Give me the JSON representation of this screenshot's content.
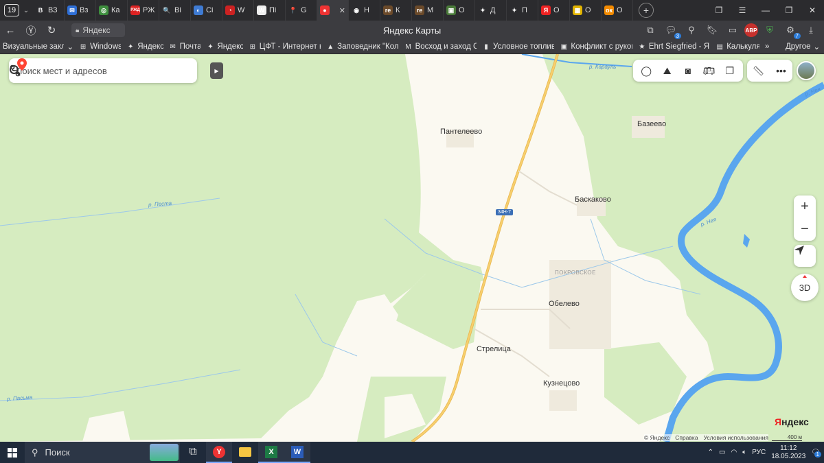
{
  "browser": {
    "tab_count": "19",
    "tabs": [
      {
        "label": "ВЗ",
        "icon": "b-logo-icon",
        "color": "#2b2b2e",
        "glyph": "B"
      },
      {
        "label": "Вз",
        "icon": "mail-icon",
        "color": "#2f6fd6",
        "glyph": "✉"
      },
      {
        "label": "Ка",
        "icon": "green-circle-icon",
        "color": "#3e8e3e",
        "glyph": "◎"
      },
      {
        "label": "РЖ",
        "icon": "rzd-icon",
        "color": "#d22",
        "glyph": "РЖД"
      },
      {
        "label": "Ві",
        "icon": "search-blue-icon",
        "color": "#2b2b2e",
        "glyph": "🔍"
      },
      {
        "label": "Сі",
        "icon": "globe-icon",
        "color": "#3f7bd3",
        "glyph": "◐"
      },
      {
        "label": "W",
        "icon": "red-swirl-icon",
        "color": "#c22",
        "glyph": "◔"
      },
      {
        "label": "Пі",
        "icon": "wikipedia-icon",
        "color": "#eee",
        "glyph": "W"
      },
      {
        "label": "G",
        "icon": "maps-pin-icon",
        "color": "#2b2b2e",
        "glyph": "📍"
      },
      {
        "label": "",
        "icon": "yandex-maps-icon",
        "color": "#e33",
        "glyph": "●",
        "active": true
      },
      {
        "label": "Н",
        "icon": "location-icon",
        "color": "#2b2b2e",
        "glyph": "◉"
      },
      {
        "label": "К",
        "icon": "re-icon",
        "color": "#6b4a2a",
        "glyph": "re"
      },
      {
        "label": "М",
        "icon": "re-icon",
        "color": "#6b4a2a",
        "glyph": "re"
      },
      {
        "label": "О",
        "icon": "picture-icon",
        "color": "#4a7a3a",
        "glyph": "▣"
      },
      {
        "label": "Д",
        "icon": "sparkle-icon",
        "color": "#2b2b2e",
        "glyph": "✦"
      },
      {
        "label": "П",
        "icon": "sparkle-icon",
        "color": "#2b2b2e",
        "glyph": "✦"
      },
      {
        "label": "О",
        "icon": "yandex-icon",
        "color": "#e22",
        "glyph": "Я"
      },
      {
        "label": "О",
        "icon": "yellow-grid-icon",
        "color": "#e2b400",
        "glyph": "▦"
      },
      {
        "label": "О",
        "icon": "ok-icon",
        "color": "#f28a00",
        "glyph": "ок"
      }
    ],
    "close_glyph": "✕",
    "new_tab_glyph": "+",
    "url_host": "Яндекс",
    "page_title": "Яндекс Карты",
    "addr_badge": "3",
    "abp_label": "ABP",
    "ext_badge": "7",
    "bookmarks": [
      {
        "label": "Визуальные закладк",
        "icon": "none",
        "glyph": ""
      },
      {
        "label": "Windows",
        "icon": "windows-icon",
        "glyph": "⊞"
      },
      {
        "label": "Яндекс",
        "icon": "sparkle-icon",
        "glyph": "✦"
      },
      {
        "label": "Почта",
        "icon": "mail-icon",
        "glyph": "✉"
      },
      {
        "label": "Яндекс",
        "icon": "sparkle-icon",
        "glyph": "✦"
      },
      {
        "label": "ЦФТ - Интернет н",
        "icon": "grid-icon",
        "glyph": "⊞"
      },
      {
        "label": "Заповедник \"Колс",
        "icon": "tree-icon",
        "glyph": "▲"
      },
      {
        "label": "Восход и заход Сс",
        "icon": "mt-icon",
        "glyph": "M"
      },
      {
        "label": "Условное топливо",
        "icon": "chart-icon",
        "glyph": "▮"
      },
      {
        "label": "Конфликт с руков",
        "icon": "photo-icon",
        "glyph": "▣"
      },
      {
        "label": "Ehrt Siegfried - Я г",
        "icon": "star-icon",
        "glyph": "★"
      },
      {
        "label": "Калькуля",
        "icon": "calc-icon",
        "glyph": "▤"
      }
    ],
    "bookmarks_more": "»",
    "bookmarks_other": "Другое"
  },
  "map": {
    "search_placeholder": "Поиск мест и адресов",
    "places": {
      "panteleevo": "Пантелеево",
      "bazeevo": "Базеево",
      "baskakovo": "Баскаково",
      "pokrovskoe": "ПОКРОВСКОЕ",
      "obelevo": "Обелево",
      "strelitsa": "Стрелица",
      "kuznetsovo": "Кузнецово"
    },
    "rivers": {
      "karaul": "р. Карауль",
      "neya_top": "р. Нея",
      "neya_mid": "р. Нея",
      "pesta": "р. Песта",
      "pasma": "р. Пасьма"
    },
    "road_number": "34Н-7",
    "zoom_in": "+",
    "zoom_out": "−",
    "btn_3d": "3D",
    "brand_first": "Я",
    "brand_rest": "ндекс",
    "footer": {
      "copyright": "© Яндекс",
      "help": "Справка",
      "terms": "Условия использования"
    },
    "scale": "400 м",
    "colors": {
      "forest": "#d6ecc0",
      "land": "#fbf9f1",
      "river": "#5aa6ee",
      "road": "#f7cf6e"
    }
  },
  "taskbar": {
    "search_label": "Поиск",
    "language": "РУС",
    "time": "11:12",
    "date": "18.05.2023",
    "notif_count": "1"
  }
}
